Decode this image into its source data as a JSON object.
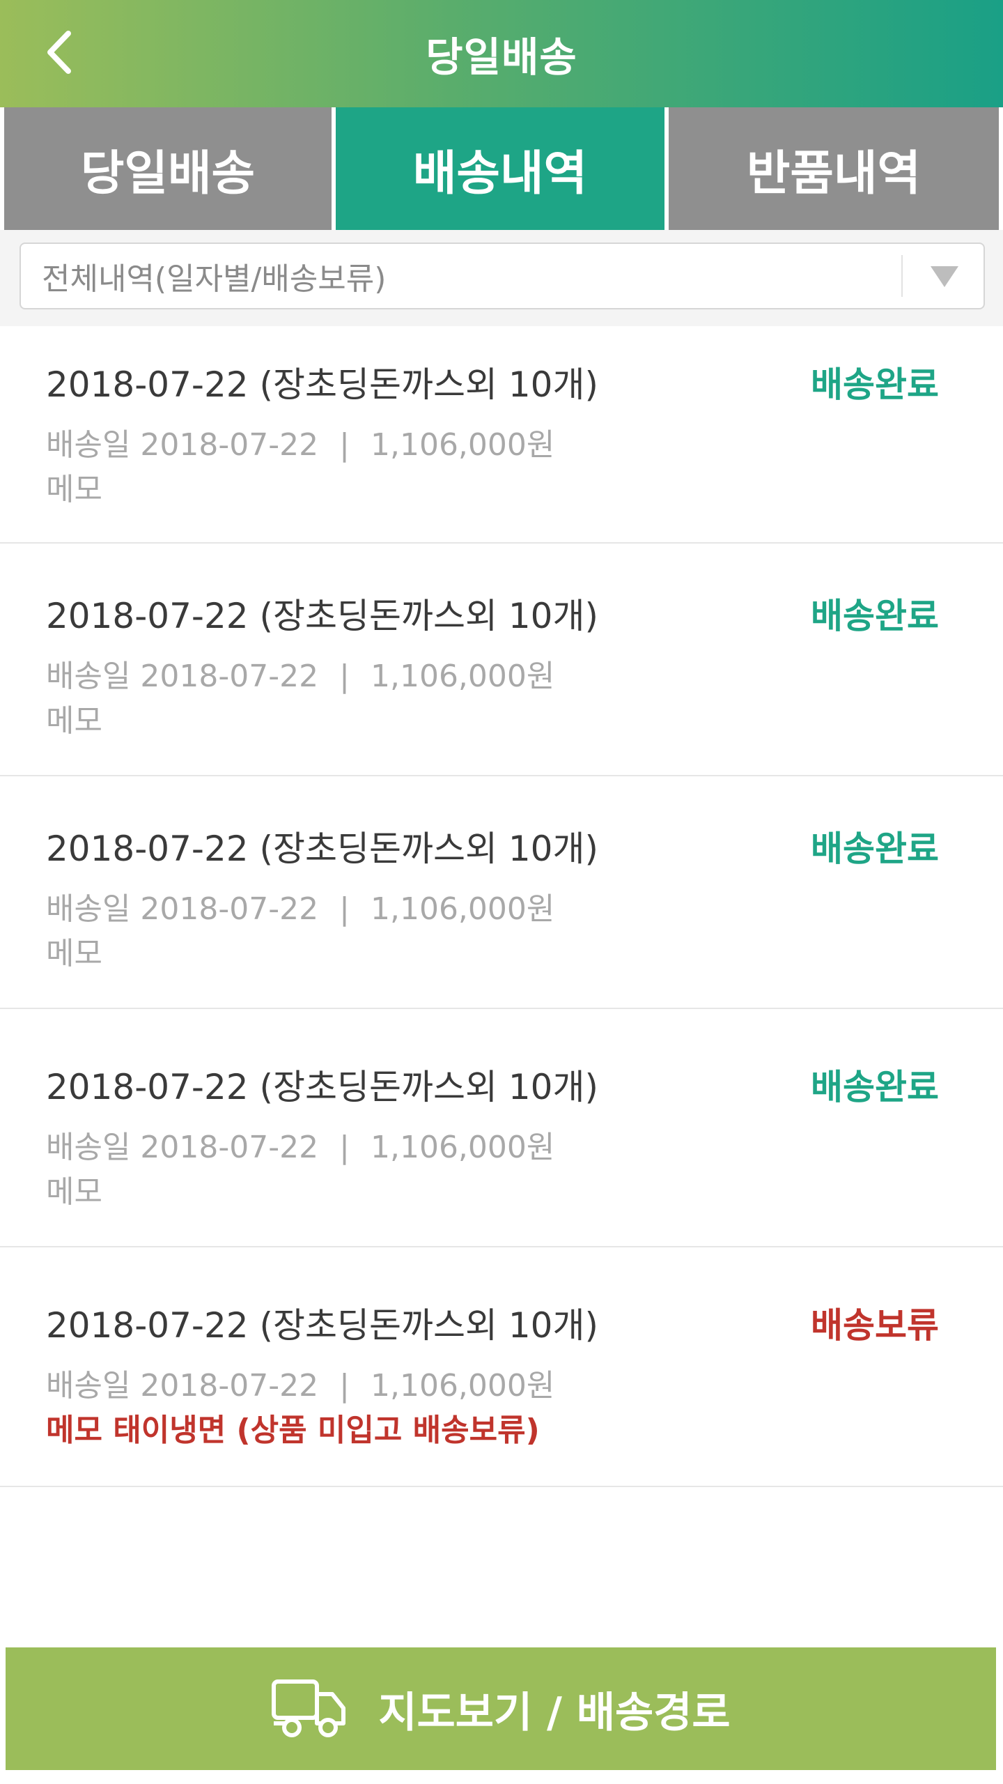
{
  "header": {
    "title": "당일배송",
    "back_icon": "chevron-left-icon"
  },
  "tabs": [
    {
      "label": "당일배송",
      "active": false
    },
    {
      "label": "배송내역",
      "active": true
    },
    {
      "label": "반품내역",
      "active": false
    }
  ],
  "filter": {
    "selected": "전체내역(일자별/배송보류)",
    "icon": "triangle-down-icon"
  },
  "orders": [
    {
      "title": "2018-07-22 (장초딩돈까스외 10개)",
      "status": "배송완료",
      "date_label": "배송일 2018-07-22",
      "separator": "|",
      "amount": "1,106,000원",
      "memo": "메모"
    },
    {
      "title": "2018-07-22 (장초딩돈까스외 10개)",
      "status": "배송완료",
      "date_label": "배송일 2018-07-22",
      "separator": "|",
      "amount": "1,106,000원",
      "memo": "메모"
    },
    {
      "title": "2018-07-22 (장초딩돈까스외 10개)",
      "status": "배송완료",
      "date_label": "배송일 2018-07-22",
      "separator": "|",
      "amount": "1,106,000원",
      "memo": "메모"
    },
    {
      "title": "2018-07-22 (장초딩돈까스외 10개)",
      "status": "배송완료",
      "date_label": "배송일 2018-07-22",
      "separator": "|",
      "amount": "1,106,000원",
      "memo": "메모"
    },
    {
      "title": "2018-07-22 (장초딩돈까스외 10개)",
      "status": "배송보류",
      "date_label": "배송일 2018-07-22",
      "separator": "|",
      "amount": "1,106,000원",
      "memo": "메모 태이냉면 (상품 미입고 배송보류)"
    }
  ],
  "status_colors": {
    "배송완료": "#1ea586",
    "배송보류": "#c0342c"
  },
  "map_button": {
    "label": "지도보기 / 배송경로",
    "icon": "truck-icon"
  }
}
